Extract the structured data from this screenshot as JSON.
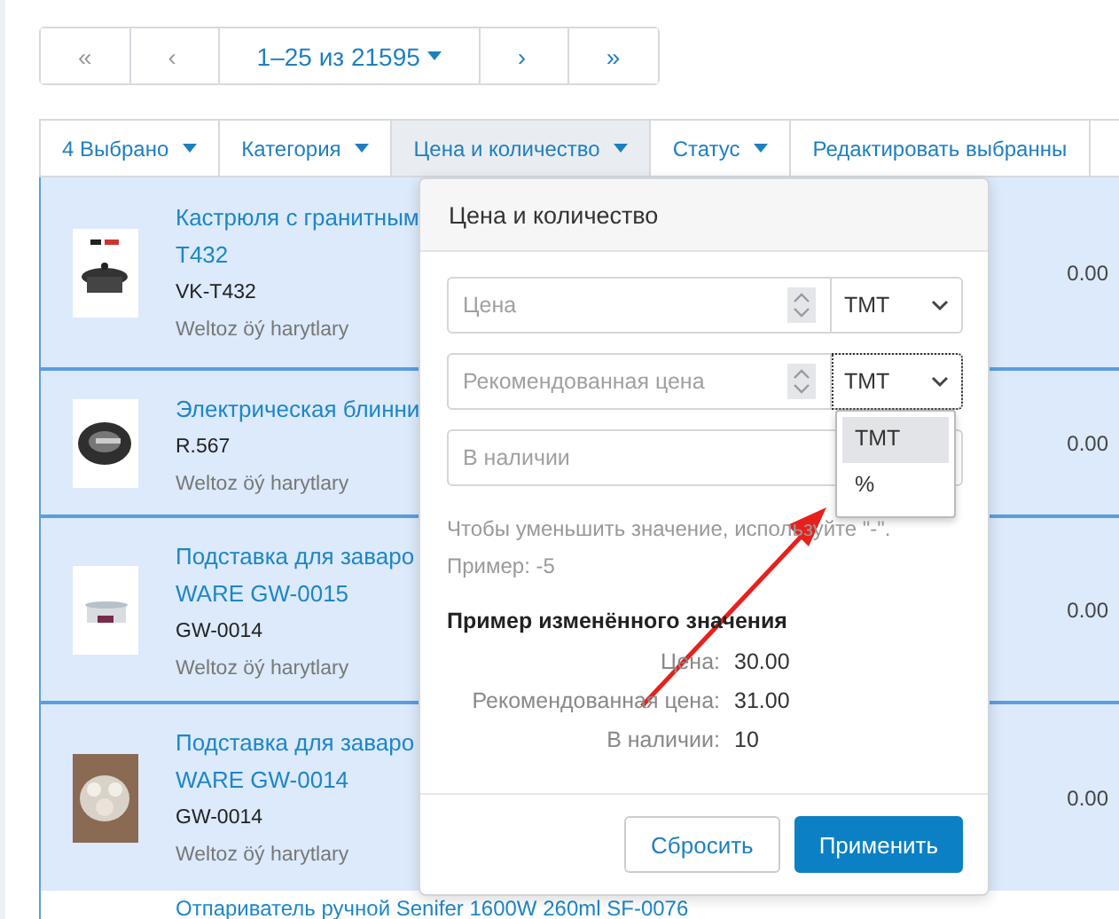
{
  "pagination": [
    {
      "label": "«",
      "kind": "button",
      "disabled": true
    },
    {
      "label": "‹",
      "kind": "button",
      "disabled": true
    },
    {
      "label": "1–25 из 21595",
      "kind": "dropdown",
      "disabled": false
    },
    {
      "label": "›",
      "kind": "button",
      "disabled": false
    },
    {
      "label": "»",
      "kind": "button",
      "disabled": false
    }
  ],
  "toolbar": [
    {
      "label": "4 Выбрано",
      "selected": false,
      "caret": true
    },
    {
      "label": "Категория",
      "selected": false,
      "caret": true
    },
    {
      "label": "Цена и количество",
      "selected": true,
      "caret": true
    },
    {
      "label": "Статус",
      "selected": false,
      "caret": true
    },
    {
      "label": "Редактировать выбранны",
      "selected": false,
      "caret": false
    }
  ],
  "products": [
    {
      "title_lines": [
        "Кастрюля с гранитным",
        "T432"
      ],
      "sku": "VK-T432",
      "brand": "Weltoz öý harytlary",
      "price": "0.00",
      "selected": true
    },
    {
      "title_lines": [
        "Электрическая блинни"
      ],
      "sku": "R.567",
      "brand": "Weltoz öý harytlary",
      "price": "0.00",
      "selected": true
    },
    {
      "title_lines": [
        "Подставка для заваро",
        "WARE GW-0015"
      ],
      "sku": "GW-0014",
      "brand": "Weltoz öý harytlary",
      "price": "0.00",
      "selected": true
    },
    {
      "title_lines": [
        "Подставка для заваро",
        "WARE GW-0014"
      ],
      "sku": "GW-0014",
      "brand": "Weltoz öý harytlary",
      "price": "0.00",
      "selected": true
    }
  ],
  "next_product": {
    "title": "Отпариватель ручной Senifer 1600W 260ml SF-0076"
  },
  "popover": {
    "title": "Цена и количество",
    "fields": [
      {
        "placeholder": "Цена",
        "kind": "currency",
        "unit": "TMT",
        "focused": false
      },
      {
        "placeholder": "Рекомендованная цена",
        "kind": "currency",
        "unit": "TMT",
        "focused": true
      },
      {
        "placeholder": "В наличии",
        "kind": "plain"
      }
    ],
    "unit_menu": [
      {
        "label": "TMT",
        "selected": true
      },
      {
        "label": "%",
        "selected": false
      }
    ],
    "hint": "Чтобы уменьшить значение, используйте \"-\". Пример: -5",
    "example": {
      "heading": "Пример изменённого значения",
      "rows": [
        {
          "label": "Цена:",
          "value": "30.00"
        },
        {
          "label": "Рекомендованная цена:",
          "value": "31.00"
        },
        {
          "label": "В наличии:",
          "value": "10"
        }
      ]
    },
    "buttons": [
      {
        "label": "Сбросить",
        "kind": "secondary"
      },
      {
        "label": "Применить",
        "kind": "primary"
      }
    ]
  },
  "annotation": {
    "kind": "arrow"
  }
}
